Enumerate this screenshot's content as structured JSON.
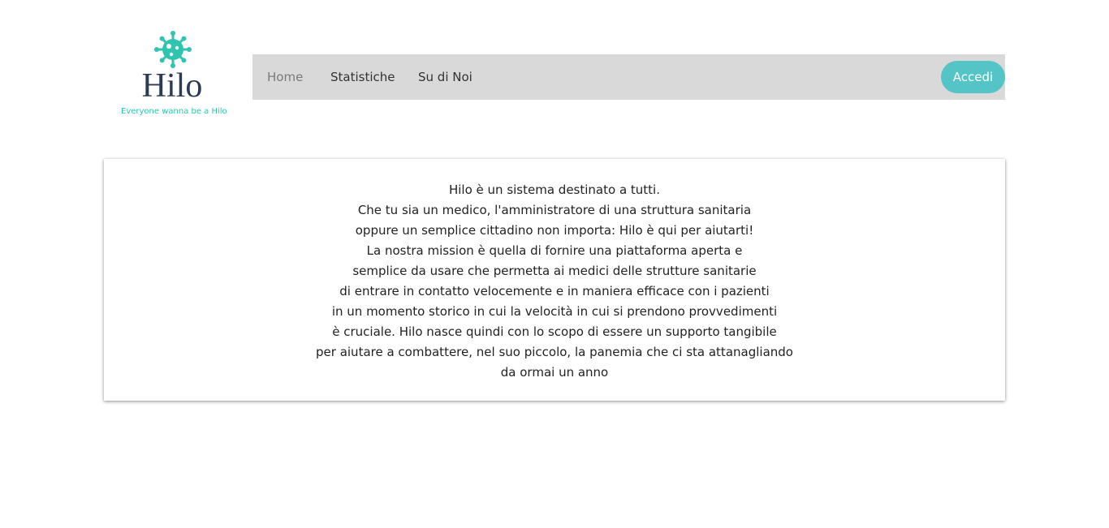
{
  "brand": {
    "name": "Hilo",
    "tagline": "Everyone wanna be a Hilo",
    "icon": "virus-icon",
    "color_primary": "#2b3a55",
    "color_accent": "#2ec4b0"
  },
  "nav": {
    "items": [
      {
        "label": "Home",
        "active": true
      },
      {
        "label": "Statistiche",
        "active": false
      },
      {
        "label": "Su di Noi",
        "active": false
      }
    ],
    "login_label": "Accedi",
    "background": "#d9d9d9",
    "login_color": "#55c4c7"
  },
  "content": {
    "lines": [
      "Hilo è un sistema destinato a tutti.",
      "Che tu sia un medico, l'amministratore di una struttura sanitaria",
      "oppure un semplice cittadino non importa: Hilo è qui per aiutarti!",
      "La nostra mission è quella di fornire una piattaforma aperta e",
      "semplice da usare che permetta ai medici delle strutture sanitarie",
      "di entrare in contatto velocemente e in maniera efficace con i pazienti",
      "in un momento storico in cui la velocità in cui si prendono provvedimenti",
      "è cruciale. Hilo nasce quindi con lo scopo di essere un supporto tangibile",
      "per aiutare a combattere, nel suo piccolo, la panemia che ci sta attanagliando",
      "da ormai un anno"
    ]
  }
}
